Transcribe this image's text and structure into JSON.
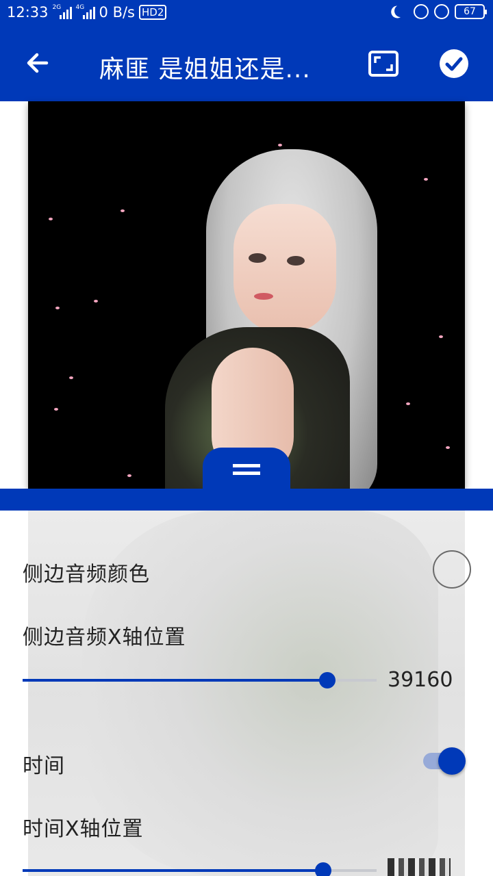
{
  "status_bar": {
    "time": "12:33",
    "net1": "2G",
    "net2": "4G",
    "speed": "0 B/s",
    "hd": "HD2",
    "battery": "67"
  },
  "app_bar": {
    "title": "麻匪 是姐姐还是...",
    "icons": {
      "back": "arrow-left-icon",
      "crop": "crop-frame-icon",
      "confirm": "check-circle-icon"
    }
  },
  "colors": {
    "primary": "#0039b8",
    "track_inactive": "#c7c9cf",
    "toggle_track": "#97aad8"
  },
  "settings": {
    "side_audio_color_label": "侧边音频颜色",
    "side_audio_x_label": "侧边音频X轴位置",
    "side_audio_x_value": "39160",
    "side_audio_x_fraction": 0.86,
    "time_label": "时间",
    "time_enabled": true,
    "time_x_label": "时间X轴位置",
    "time_x_fraction": 0.85
  }
}
